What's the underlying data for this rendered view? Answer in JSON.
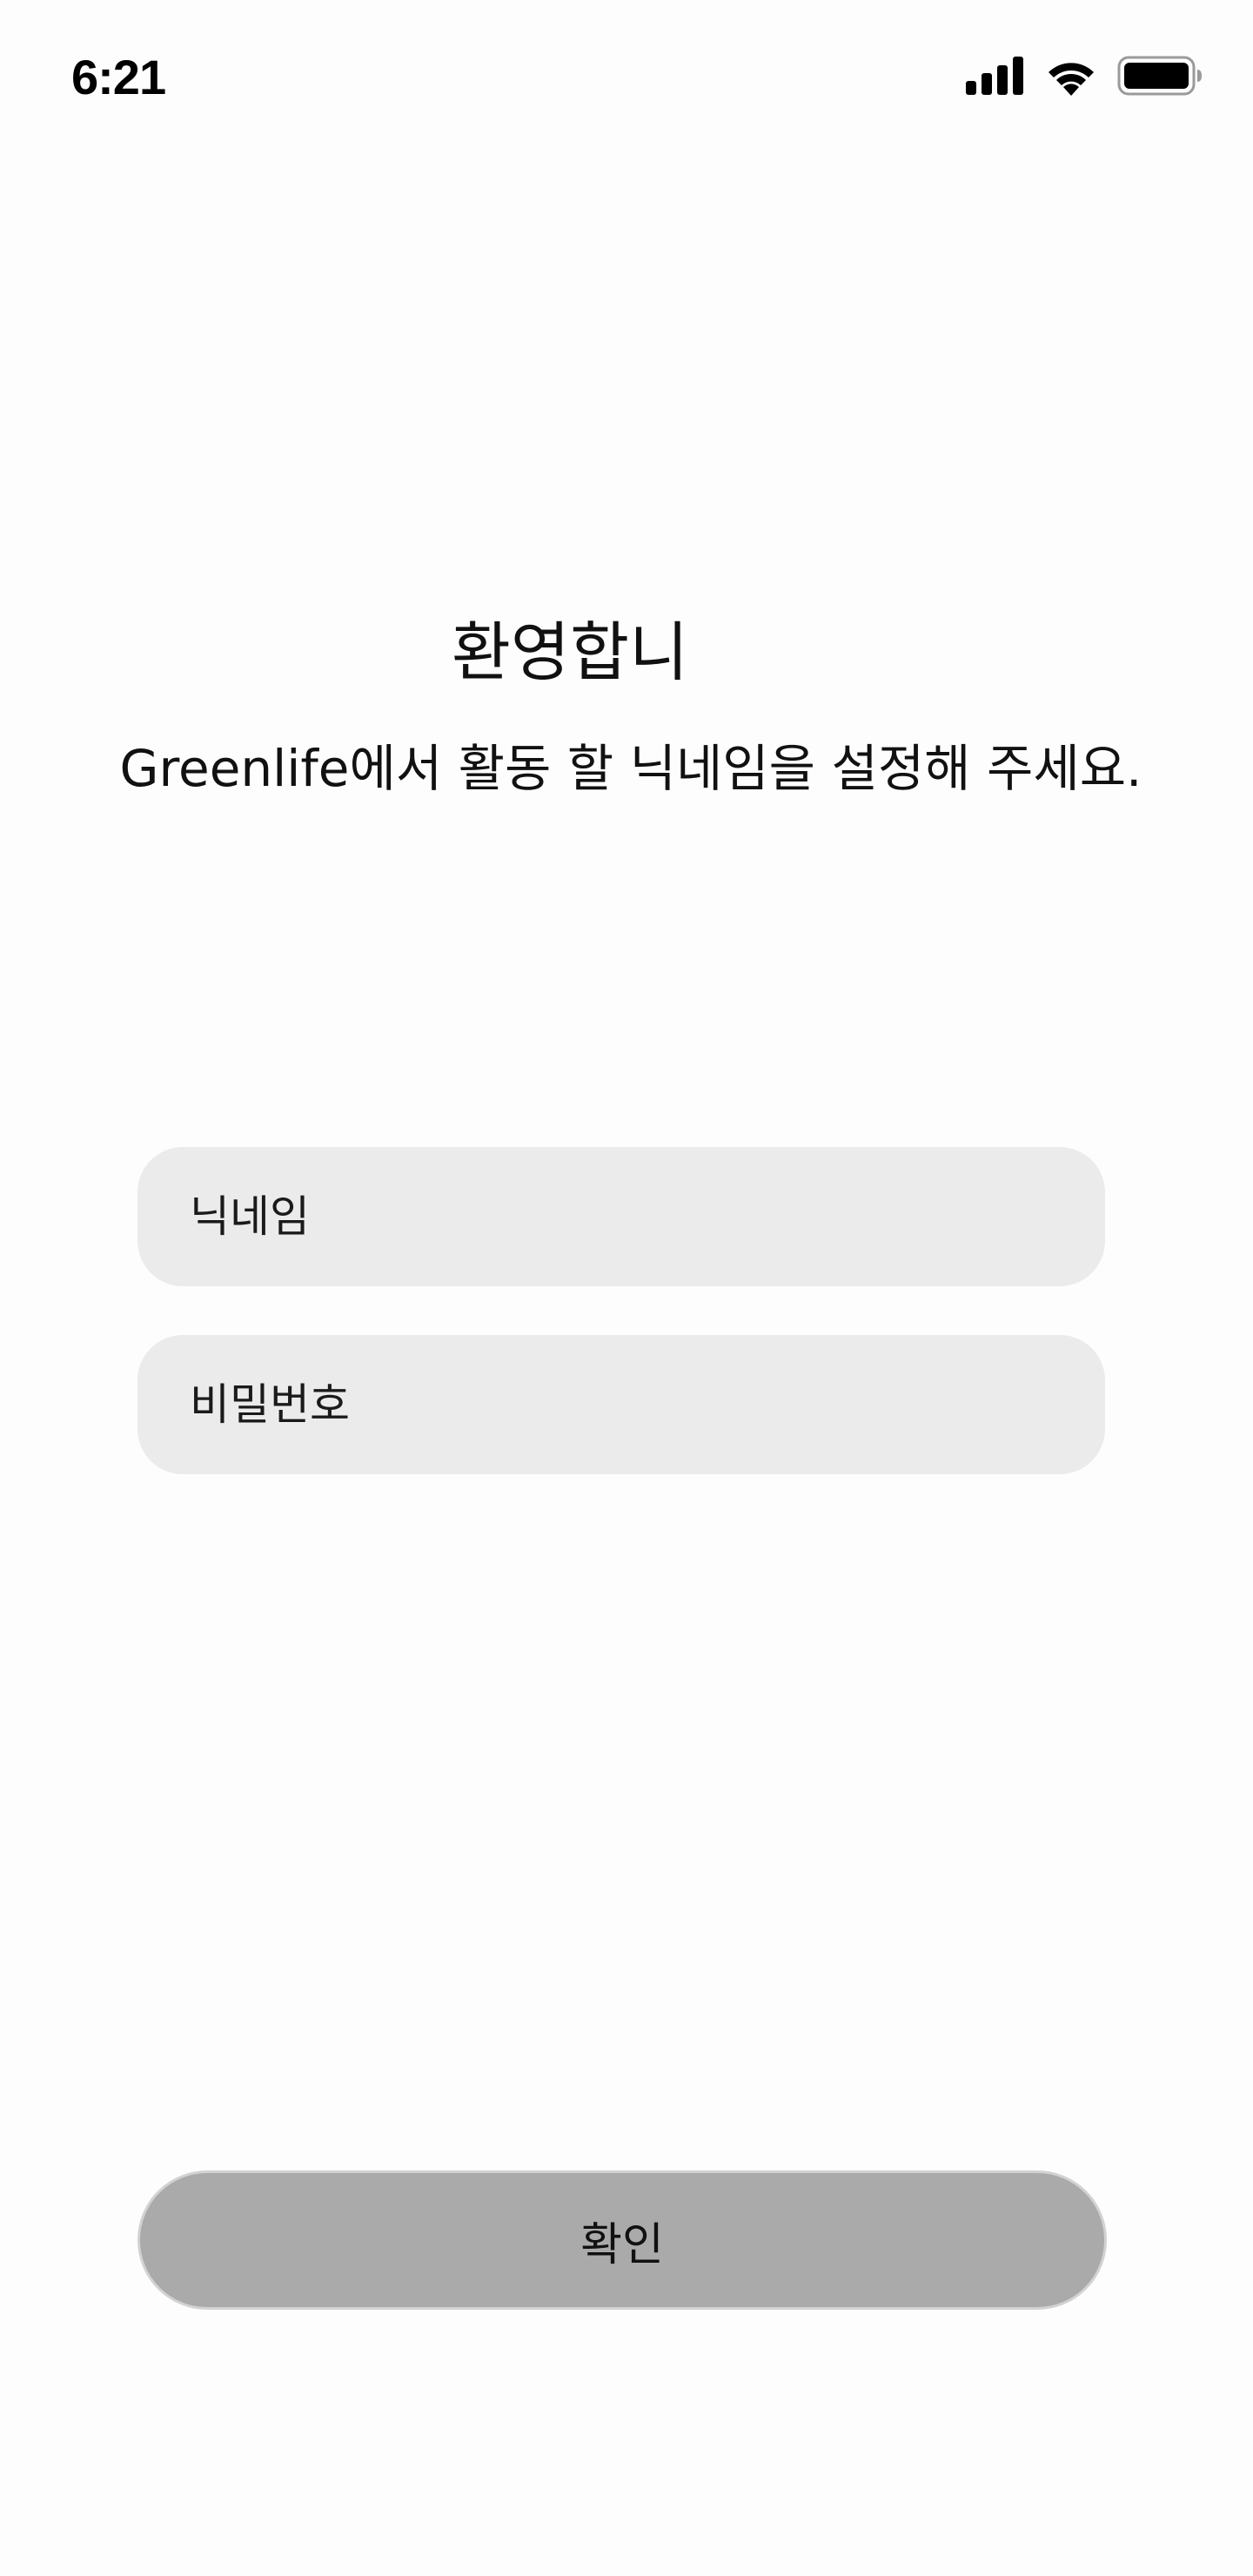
{
  "status_bar": {
    "time": "6:21",
    "icons": [
      "cellular-signal-icon",
      "wifi-icon",
      "battery-icon"
    ]
  },
  "welcome": {
    "title": "환영합니",
    "subtitle": "Greenlife에서 활동 할 닉네임을 설정해 주세요."
  },
  "form": {
    "nickname_placeholder": "닉네임",
    "password_placeholder": "비밀번호",
    "confirm_label": "확인"
  },
  "colors": {
    "background": "#fdfdfd",
    "field_background": "#ebebeb",
    "button_background": "#aaaaaa",
    "button_border": "#d2d2d2",
    "text": "#111111"
  }
}
